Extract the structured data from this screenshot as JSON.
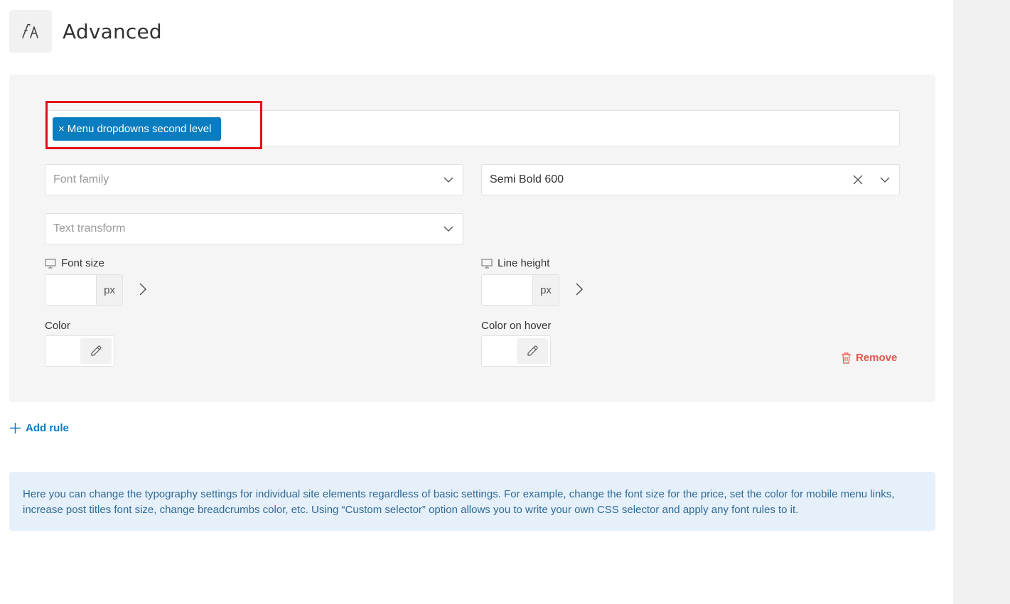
{
  "header": {
    "title": "Advanced",
    "icon": "typography-icon"
  },
  "rule": {
    "selector_tag": "Menu dropdowns second level",
    "selector_tag_remove": "×",
    "font_family": {
      "placeholder": "Font family",
      "value": ""
    },
    "font_weight": {
      "value": "Semi Bold 600"
    },
    "text_transform": {
      "placeholder": "Text transform",
      "value": ""
    },
    "font_size": {
      "label": "Font size",
      "unit": "px",
      "value": ""
    },
    "line_height": {
      "label": "Line height",
      "unit": "px",
      "value": ""
    },
    "color": {
      "label": "Color"
    },
    "color_hover": {
      "label": "Color on hover"
    },
    "remove_label": "Remove"
  },
  "add_rule_label": "Add rule",
  "info_text": "Here you can change the typography settings for individual site elements regardless of basic settings. For example, change the font size for the price, set the color for mobile menu links, increase post titles font size, change breadcrumbs color, etc. Using “Custom selector” option allows you to write your own CSS selector and apply any font rules to it.",
  "colors": {
    "accent": "#0a7cc0",
    "danger": "#e8554e",
    "highlight": "#e5101a",
    "info_bg": "#e6f0fa",
    "info_text": "#2f6a96",
    "panel_bg": "#f5f5f5"
  }
}
